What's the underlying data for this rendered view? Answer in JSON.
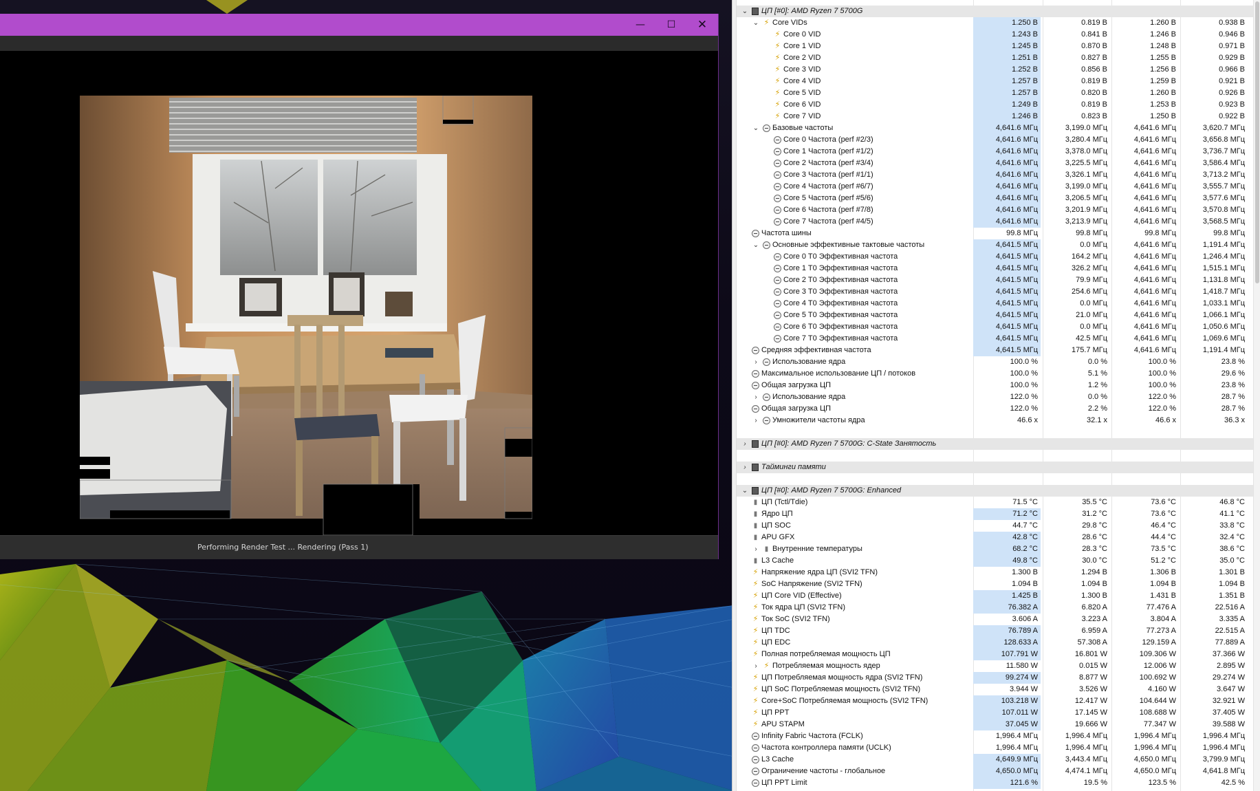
{
  "render_window": {
    "title": "",
    "controls": {
      "minimize": "—",
      "maximize": "☐",
      "close": "✕"
    },
    "status": "Performing Render Test ... Rendering (Pass 1)"
  },
  "hwinfo": {
    "sections": [
      {
        "title": "ЦП [#0]: AMD Ryzen 7 5700G",
        "expanded": true,
        "rows": [
          {
            "label": "Core VIDs",
            "icon": "bolt",
            "indent": 1,
            "chev": "down",
            "v": [
              "1.250 В",
              "0.819 В",
              "1.260 В",
              "0.938 В"
            ],
            "hl": true
          },
          {
            "label": "Core 0 VID",
            "icon": "bolt",
            "indent": 2,
            "v": [
              "1.243 В",
              "0.841 В",
              "1.246 В",
              "0.946 В"
            ],
            "hl": true
          },
          {
            "label": "Core 1 VID",
            "icon": "bolt",
            "indent": 2,
            "v": [
              "1.245 В",
              "0.870 В",
              "1.248 В",
              "0.971 В"
            ],
            "hl": true
          },
          {
            "label": "Core 2 VID",
            "icon": "bolt",
            "indent": 2,
            "v": [
              "1.251 В",
              "0.827 В",
              "1.255 В",
              "0.929 В"
            ],
            "hl": true
          },
          {
            "label": "Core 3 VID",
            "icon": "bolt",
            "indent": 2,
            "v": [
              "1.252 В",
              "0.856 В",
              "1.256 В",
              "0.966 В"
            ],
            "hl": true
          },
          {
            "label": "Core 4 VID",
            "icon": "bolt",
            "indent": 2,
            "v": [
              "1.257 В",
              "0.819 В",
              "1.259 В",
              "0.921 В"
            ],
            "hl": true
          },
          {
            "label": "Core 5 VID",
            "icon": "bolt",
            "indent": 2,
            "v": [
              "1.257 В",
              "0.820 В",
              "1.260 В",
              "0.926 В"
            ],
            "hl": true
          },
          {
            "label": "Core 6 VID",
            "icon": "bolt",
            "indent": 2,
            "v": [
              "1.249 В",
              "0.819 В",
              "1.253 В",
              "0.923 В"
            ],
            "hl": true
          },
          {
            "label": "Core 7 VID",
            "icon": "bolt",
            "indent": 2,
            "v": [
              "1.246 В",
              "0.823 В",
              "1.250 В",
              "0.922 В"
            ],
            "hl": true
          },
          {
            "label": "Базовые частоты",
            "icon": "clock",
            "indent": 1,
            "chev": "down",
            "v": [
              "4,641.6 МГц",
              "3,199.0 МГц",
              "4,641.6 МГц",
              "3,620.7 МГц"
            ],
            "hl": true
          },
          {
            "label": "Core 0 Частота (perf #2/3)",
            "icon": "clock",
            "indent": 2,
            "v": [
              "4,641.6 МГц",
              "3,280.4 МГц",
              "4,641.6 МГц",
              "3,656.8 МГц"
            ],
            "hl": true
          },
          {
            "label": "Core 1 Частота (perf #1/2)",
            "icon": "clock",
            "indent": 2,
            "v": [
              "4,641.6 МГц",
              "3,378.0 МГц",
              "4,641.6 МГц",
              "3,736.7 МГц"
            ],
            "hl": true
          },
          {
            "label": "Core 2 Частота (perf #3/4)",
            "icon": "clock",
            "indent": 2,
            "v": [
              "4,641.6 МГц",
              "3,225.5 МГц",
              "4,641.6 МГц",
              "3,586.4 МГц"
            ],
            "hl": true
          },
          {
            "label": "Core 3 Частота (perf #1/1)",
            "icon": "clock",
            "indent": 2,
            "v": [
              "4,641.6 МГц",
              "3,326.1 МГц",
              "4,641.6 МГц",
              "3,713.2 МГц"
            ],
            "hl": true
          },
          {
            "label": "Core 4 Частота (perf #6/7)",
            "icon": "clock",
            "indent": 2,
            "v": [
              "4,641.6 МГц",
              "3,199.0 МГц",
              "4,641.6 МГц",
              "3,555.7 МГц"
            ],
            "hl": true
          },
          {
            "label": "Core 5 Частота (perf #5/6)",
            "icon": "clock",
            "indent": 2,
            "v": [
              "4,641.6 МГц",
              "3,206.5 МГц",
              "4,641.6 МГц",
              "3,577.6 МГц"
            ],
            "hl": true
          },
          {
            "label": "Core 6 Частота (perf #7/8)",
            "icon": "clock",
            "indent": 2,
            "v": [
              "4,641.6 МГц",
              "3,201.9 МГц",
              "4,641.6 МГц",
              "3,570.8 МГц"
            ],
            "hl": true
          },
          {
            "label": "Core 7 Частота (perf #4/5)",
            "icon": "clock",
            "indent": 2,
            "v": [
              "4,641.6 МГц",
              "3,213.9 МГц",
              "4,641.6 МГц",
              "3,568.5 МГц"
            ],
            "hl": true
          },
          {
            "label": "Частота шины",
            "icon": "clock",
            "indent": 0,
            "v": [
              "99.8 МГц",
              "99.8 МГц",
              "99.8 МГц",
              "99.8 МГц"
            ],
            "hl": false
          },
          {
            "label": "Основные эффективные тактовые частоты",
            "icon": "clock",
            "indent": 1,
            "chev": "down",
            "v": [
              "4,641.5 МГц",
              "0.0 МГц",
              "4,641.6 МГц",
              "1,191.4 МГц"
            ],
            "hl": true
          },
          {
            "label": "Core 0 T0 Эффективная частота",
            "icon": "clock",
            "indent": 2,
            "v": [
              "4,641.5 МГц",
              "164.2 МГц",
              "4,641.6 МГц",
              "1,246.4 МГц"
            ],
            "hl": true
          },
          {
            "label": "Core 1 T0 Эффективная частота",
            "icon": "clock",
            "indent": 2,
            "v": [
              "4,641.5 МГц",
              "326.2 МГц",
              "4,641.6 МГц",
              "1,515.1 МГц"
            ],
            "hl": true
          },
          {
            "label": "Core 2 T0 Эффективная частота",
            "icon": "clock",
            "indent": 2,
            "v": [
              "4,641.5 МГц",
              "79.9 МГц",
              "4,641.6 МГц",
              "1,131.8 МГц"
            ],
            "hl": true
          },
          {
            "label": "Core 3 T0 Эффективная частота",
            "icon": "clock",
            "indent": 2,
            "v": [
              "4,641.5 МГц",
              "254.6 МГц",
              "4,641.6 МГц",
              "1,418.7 МГц"
            ],
            "hl": true
          },
          {
            "label": "Core 4 T0 Эффективная частота",
            "icon": "clock",
            "indent": 2,
            "v": [
              "4,641.5 МГц",
              "0.0 МГц",
              "4,641.6 МГц",
              "1,033.1 МГц"
            ],
            "hl": true
          },
          {
            "label": "Core 5 T0 Эффективная частота",
            "icon": "clock",
            "indent": 2,
            "v": [
              "4,641.5 МГц",
              "21.0 МГц",
              "4,641.6 МГц",
              "1,066.1 МГц"
            ],
            "hl": true
          },
          {
            "label": "Core 6 T0 Эффективная частота",
            "icon": "clock",
            "indent": 2,
            "v": [
              "4,641.5 МГц",
              "0.0 МГц",
              "4,641.6 МГц",
              "1,050.6 МГц"
            ],
            "hl": true
          },
          {
            "label": "Core 7 T0 Эффективная частота",
            "icon": "clock",
            "indent": 2,
            "v": [
              "4,641.5 МГц",
              "42.5 МГц",
              "4,641.6 МГц",
              "1,069.6 МГц"
            ],
            "hl": true
          },
          {
            "label": "Средняя эффективная частота",
            "icon": "clock",
            "indent": 0,
            "v": [
              "4,641.5 МГц",
              "175.7 МГц",
              "4,641.6 МГц",
              "1,191.4 МГц"
            ],
            "hl": true
          },
          {
            "label": "Использование ядра",
            "icon": "clock",
            "indent": 1,
            "chev": "right",
            "v": [
              "100.0 %",
              "0.0 %",
              "100.0 %",
              "23.8 %"
            ],
            "hl": false
          },
          {
            "label": "Максимальное использование ЦП / потоков",
            "icon": "clock",
            "indent": 0,
            "v": [
              "100.0 %",
              "5.1 %",
              "100.0 %",
              "29.6 %"
            ],
            "hl": false
          },
          {
            "label": "Общая загрузка ЦП",
            "icon": "clock",
            "indent": 0,
            "v": [
              "100.0 %",
              "1.2 %",
              "100.0 %",
              "23.8 %"
            ],
            "hl": false
          },
          {
            "label": "Использование ядра",
            "icon": "clock",
            "indent": 1,
            "chev": "right",
            "v": [
              "122.0 %",
              "0.0 %",
              "122.0 %",
              "28.7 %"
            ],
            "hl": false
          },
          {
            "label": "Общая загрузка ЦП",
            "icon": "clock",
            "indent": 0,
            "v": [
              "122.0 %",
              "2.2 %",
              "122.0 %",
              "28.7 %"
            ],
            "hl": false
          },
          {
            "label": "Умножители частоты ядра",
            "icon": "clock",
            "indent": 1,
            "chev": "right",
            "v": [
              "46.6 x",
              "32.1 x",
              "46.6 x",
              "36.3 x"
            ],
            "hl": false
          }
        ]
      },
      {
        "title": "ЦП [#0]: AMD Ryzen 7 5700G: C-State Занятость",
        "expanded": false,
        "rows": []
      },
      {
        "title": "Тайминги памяти",
        "expanded": false,
        "rows": []
      },
      {
        "title": "ЦП [#0]: AMD Ryzen 7 5700G: Enhanced",
        "expanded": true,
        "rows": [
          {
            "label": "ЦП (Tctl/Tdie)",
            "icon": "therm",
            "indent": 0,
            "v": [
              "71.5 °C",
              "35.5 °C",
              "73.6 °C",
              "46.8 °C"
            ],
            "hl": false
          },
          {
            "label": "Ядро ЦП",
            "icon": "therm",
            "indent": 0,
            "v": [
              "71.2 °C",
              "31.2 °C",
              "73.6 °C",
              "41.1 °C"
            ],
            "hl": true
          },
          {
            "label": "ЦП SOC",
            "icon": "therm",
            "indent": 0,
            "v": [
              "44.7 °C",
              "29.8 °C",
              "46.4 °C",
              "33.8 °C"
            ],
            "hl": false
          },
          {
            "label": "APU GFX",
            "icon": "therm",
            "indent": 0,
            "v": [
              "42.8 °C",
              "28.6 °C",
              "44.4 °C",
              "32.4 °C"
            ],
            "hl": true
          },
          {
            "label": "Внутренние температуры",
            "icon": "therm",
            "indent": 1,
            "chev": "right",
            "v": [
              "68.2 °C",
              "28.3 °C",
              "73.5 °C",
              "38.6 °C"
            ],
            "hl": true
          },
          {
            "label": "L3 Cache",
            "icon": "therm",
            "indent": 0,
            "v": [
              "49.8 °C",
              "30.0 °C",
              "51.2 °C",
              "35.0 °C"
            ],
            "hl": true
          },
          {
            "label": "Напряжение ядра ЦП (SVI2 TFN)",
            "icon": "bolt",
            "indent": 0,
            "v": [
              "1.300 В",
              "1.294 В",
              "1.306 В",
              "1.301 В"
            ],
            "hl": false
          },
          {
            "label": "SoC Напряжение (SVI2 TFN)",
            "icon": "bolt",
            "indent": 0,
            "v": [
              "1.094 В",
              "1.094 В",
              "1.094 В",
              "1.094 В"
            ],
            "hl": false
          },
          {
            "label": "ЦП Core VID (Effective)",
            "icon": "bolt",
            "indent": 0,
            "v": [
              "1.425 В",
              "1.300 В",
              "1.431 В",
              "1.351 В"
            ],
            "hl": true
          },
          {
            "label": "Ток ядра ЦП (SVI2 TFN)",
            "icon": "bolt",
            "indent": 0,
            "v": [
              "76.382 A",
              "6.820 A",
              "77.476 A",
              "22.516 A"
            ],
            "hl": true
          },
          {
            "label": "Ток SoC (SVI2 TFN)",
            "icon": "bolt",
            "indent": 0,
            "v": [
              "3.606 A",
              "3.223 A",
              "3.804 A",
              "3.335 A"
            ],
            "hl": false
          },
          {
            "label": "ЦП TDC",
            "icon": "bolt",
            "indent": 0,
            "v": [
              "76.789 A",
              "6.959 A",
              "77.273 A",
              "22.515 A"
            ],
            "hl": true
          },
          {
            "label": "ЦП EDC",
            "icon": "bolt",
            "indent": 0,
            "v": [
              "128.633 A",
              "57.308 A",
              "129.159 A",
              "77.889 A"
            ],
            "hl": true
          },
          {
            "label": "Полная потребляемая мощность ЦП",
            "icon": "bolt",
            "indent": 0,
            "v": [
              "107.791 W",
              "16.801 W",
              "109.306 W",
              "37.366 W"
            ],
            "hl": true
          },
          {
            "label": "Потребляемая мощность ядер",
            "icon": "bolt",
            "indent": 1,
            "chev": "right",
            "v": [
              "11.580 W",
              "0.015 W",
              "12.006 W",
              "2.895 W"
            ],
            "hl": false
          },
          {
            "label": "ЦП Потребляемая мощность ядра (SVI2 TFN)",
            "icon": "bolt",
            "indent": 0,
            "v": [
              "99.274 W",
              "8.877 W",
              "100.692 W",
              "29.274 W"
            ],
            "hl": true
          },
          {
            "label": "ЦП SoC Потребляемая мощность (SVI2 TFN)",
            "icon": "bolt",
            "indent": 0,
            "v": [
              "3.944 W",
              "3.526 W",
              "4.160 W",
              "3.647 W"
            ],
            "hl": false
          },
          {
            "label": "Core+SoC Потребляемая мощность (SVI2 TFN)",
            "icon": "bolt",
            "indent": 0,
            "v": [
              "103.218 W",
              "12.417 W",
              "104.644 W",
              "32.921 W"
            ],
            "hl": true
          },
          {
            "label": "ЦП PPT",
            "icon": "bolt",
            "indent": 0,
            "v": [
              "107.011 W",
              "17.145 W",
              "108.688 W",
              "37.405 W"
            ],
            "hl": true
          },
          {
            "label": "APU STAPM",
            "icon": "bolt",
            "indent": 0,
            "v": [
              "37.045 W",
              "19.666 W",
              "77.347 W",
              "39.588 W"
            ],
            "hl": true
          },
          {
            "label": "Infinity Fabric Частота (FCLK)",
            "icon": "clock",
            "indent": 0,
            "v": [
              "1,996.4 МГц",
              "1,996.4 МГц",
              "1,996.4 МГц",
              "1,996.4 МГц"
            ],
            "hl": false
          },
          {
            "label": "Частота контроллера памяти (UCLK)",
            "icon": "clock",
            "indent": 0,
            "v": [
              "1,996.4 МГц",
              "1,996.4 МГц",
              "1,996.4 МГц",
              "1,996.4 МГц"
            ],
            "hl": false
          },
          {
            "label": "L3 Cache",
            "icon": "clock",
            "indent": 0,
            "v": [
              "4,649.9 МГц",
              "3,443.4 МГц",
              "4,650.0 МГц",
              "3,799.9 МГц"
            ],
            "hl": true
          },
          {
            "label": "Ограничение частоты - глобальное",
            "icon": "clock",
            "indent": 0,
            "v": [
              "4,650.0 МГц",
              "4,474.1 МГц",
              "4,650.0 МГц",
              "4,641.8 МГц"
            ],
            "hl": true
          },
          {
            "label": "ЦП PPT Limit",
            "icon": "clock",
            "indent": 0,
            "v": [
              "121.6 %",
              "19.5 %",
              "123.5 %",
              "42.5 %"
            ],
            "hl": true
          }
        ]
      }
    ]
  },
  "colors": {
    "titlebar": "#b14ccc",
    "highlight": "#cfe3f8",
    "group_bg": "#e6e6e6"
  }
}
